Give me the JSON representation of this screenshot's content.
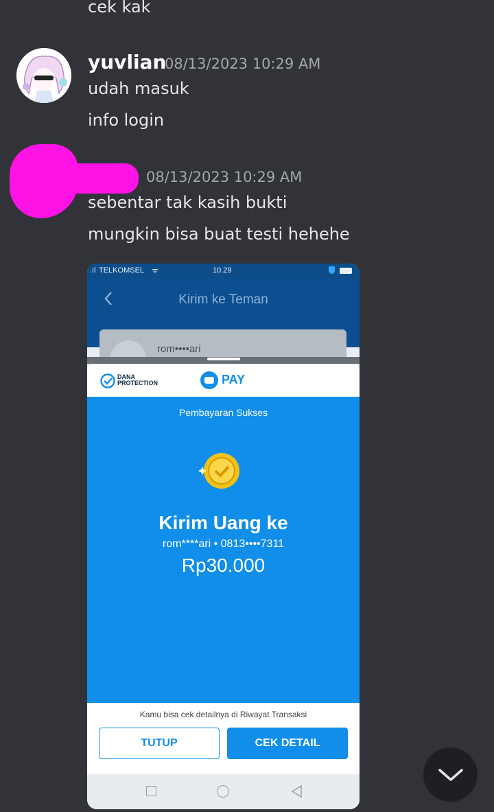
{
  "messages": {
    "prev_text": "cek kak",
    "msg1": {
      "username": "yuvlian",
      "timestamp": "08/13/2023 10:29 AM",
      "lines": [
        "udah masuk",
        "info login"
      ]
    },
    "msg2": {
      "timestamp": "08/13/2023 10:29 AM",
      "lines": [
        "sebentar tak kasih bukti",
        "mungkin bisa buat testi hehehe"
      ]
    }
  },
  "attachment": {
    "status_bar": {
      "carrier": "TELKOMSEL",
      "time": "10.29"
    },
    "app_title": "Kirim ke Teman",
    "bg_contact": "rom••••ari",
    "header": {
      "protection_line1": "DANA",
      "protection_line2": "PROTECTION",
      "pay_label": "PAY"
    },
    "receipt": {
      "status": "Pembayaran Sukses",
      "title": "Kirim Uang ke",
      "recipient": "rom****ari • 0813••••7311",
      "amount": "Rp30.000"
    },
    "footer_note": "Kamu bisa cek detailnya di Riwayat Transaksi",
    "buttons": {
      "close": "TUTUP",
      "detail": "CEK DETAIL"
    }
  },
  "colors": {
    "background": "#313338",
    "dana_blue": "#118ee9",
    "redaction": "#ff12e6"
  }
}
